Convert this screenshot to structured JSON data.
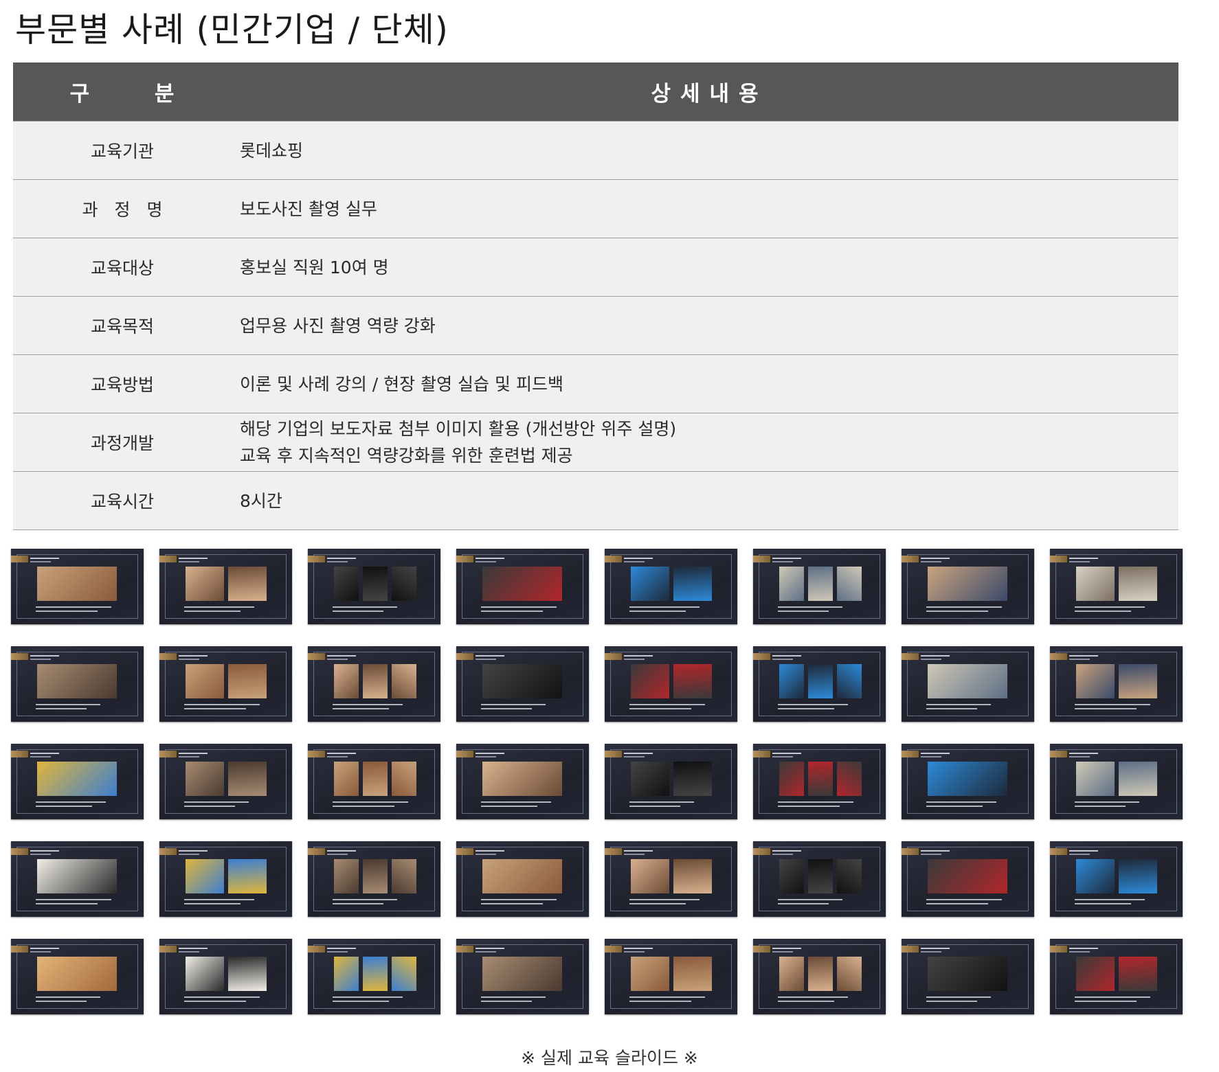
{
  "title": "부문별 사례 (민간기업 / 단체)",
  "table": {
    "headers": [
      "구 분",
      "상세내용"
    ],
    "rows": [
      {
        "label": "교육기관",
        "value": "롯데쇼핑"
      },
      {
        "label": "과 정 명",
        "value": "보도사진 촬영 실무"
      },
      {
        "label": "교육대상",
        "value": "홍보실 직원 10여 명"
      },
      {
        "label": "교육목적",
        "value": "업무용 사진 촬영 역량 강화"
      },
      {
        "label": "교육방법",
        "value": "이론 및 사례 강의 / 현장 촬영 실습 및 피드백"
      },
      {
        "label": "과정개발",
        "value": "해당 기업의 보도자료 첨부 이미지 활용 (개선방안 위주 설명)",
        "value2": "교육 후 지속적인 역량강화를 위한 훈련법 제공"
      },
      {
        "label": "교육시간",
        "value": "8시간"
      }
    ]
  },
  "slides_count": 40,
  "caption": "※ 실제 교육 슬라이드 ※"
}
